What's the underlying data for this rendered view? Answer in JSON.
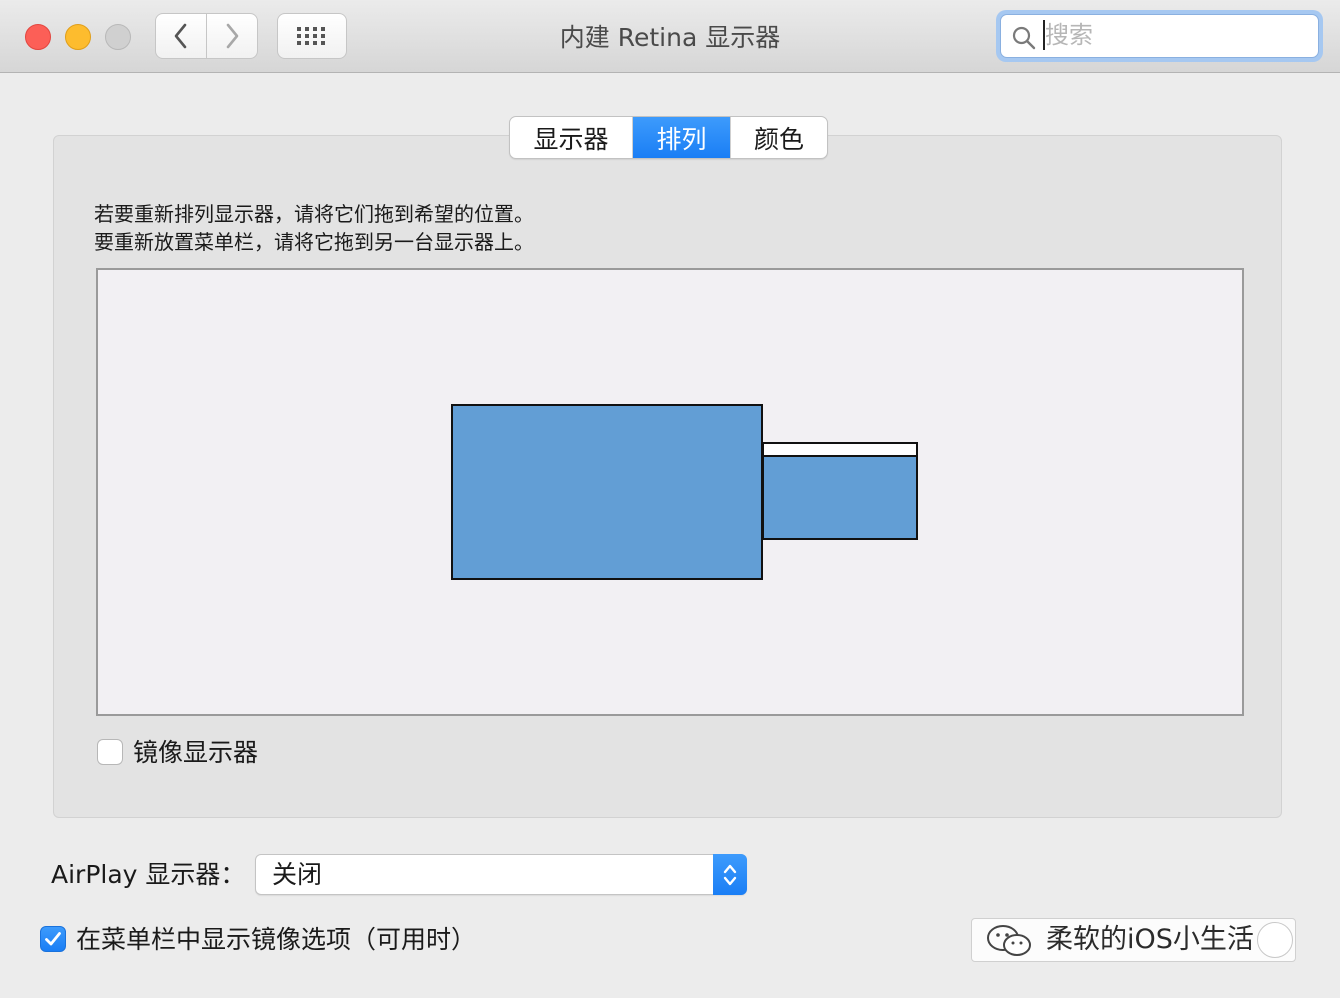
{
  "window": {
    "title": "内建 Retina 显示器"
  },
  "toolbar": {
    "back_icon": "chevron-left-icon",
    "forward_icon": "chevron-right-icon",
    "grid_icon": "grid-icon"
  },
  "search": {
    "placeholder": "搜索",
    "value": ""
  },
  "tabs": [
    {
      "label": "显示器",
      "active": false
    },
    {
      "label": "排列",
      "active": true
    },
    {
      "label": "颜色",
      "active": false
    }
  ],
  "arrangement": {
    "instruction_line1": "若要重新排列显示器，请将它们拖到希望的位置。",
    "instruction_line2": "要重新放置菜单栏，请将它拖到另一台显示器上。",
    "display_color": "#629ed5"
  },
  "mirror": {
    "label": "镜像显示器",
    "checked": false
  },
  "airplay": {
    "label": "AirPlay 显示器：",
    "selected": "关闭"
  },
  "menubar_option": {
    "label": "在菜单栏中显示镜像选项（可用时）",
    "checked": true
  },
  "watermark": {
    "text": "柔软的iOS小生活"
  },
  "colors": {
    "accent": "#1a7ef5",
    "close": "#fc5f57",
    "minimize": "#fdbc2e",
    "zoom_disabled": "#d0d0d0"
  }
}
